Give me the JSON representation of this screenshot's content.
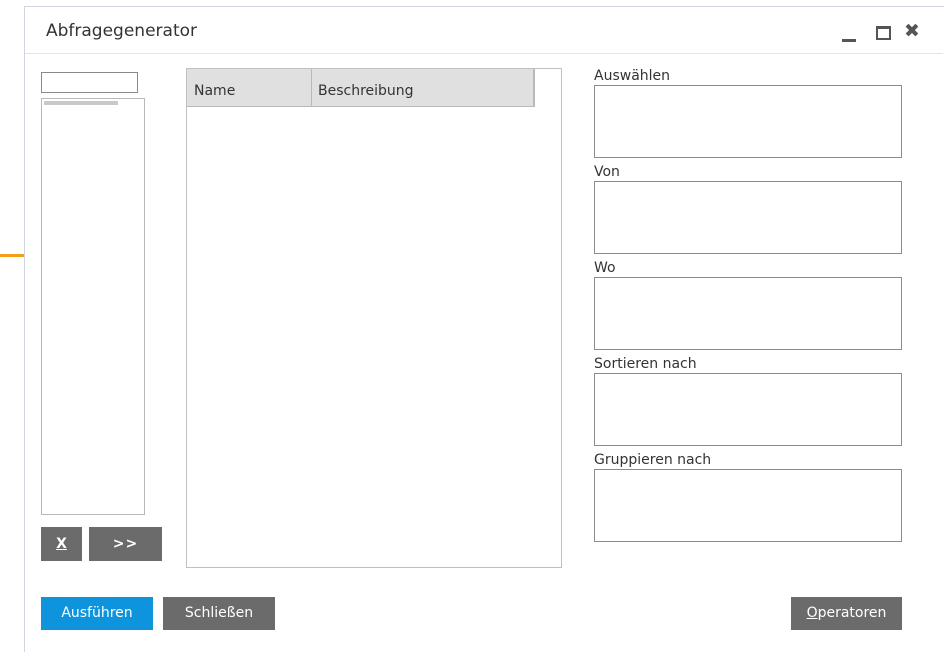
{
  "window": {
    "title": "Abfragegenerator",
    "controls": {
      "minimize_icon": "minimize-icon",
      "maximize_icon": "maximize-icon",
      "close_icon": "close-icon",
      "close_glyph": "✖"
    }
  },
  "left_panel": {
    "search_value": "",
    "remove_label": "X",
    "add_label": ">>"
  },
  "grid": {
    "columns": [
      "Name",
      "Beschreibung"
    ]
  },
  "sections": {
    "select_label": "Auswählen",
    "from_label": "Von",
    "where_label": "Wo",
    "order_label": "Sortieren nach",
    "group_label": "Gruppieren nach"
  },
  "buttons": {
    "run_label": "Ausführen",
    "close_label": "Schließen",
    "operators_first": "O",
    "operators_rest": "peratoren"
  },
  "colors": {
    "primary_button": "#0d94dc",
    "secondary_button": "#6b6b6b",
    "annotation_arrow": "#f0a01a"
  }
}
